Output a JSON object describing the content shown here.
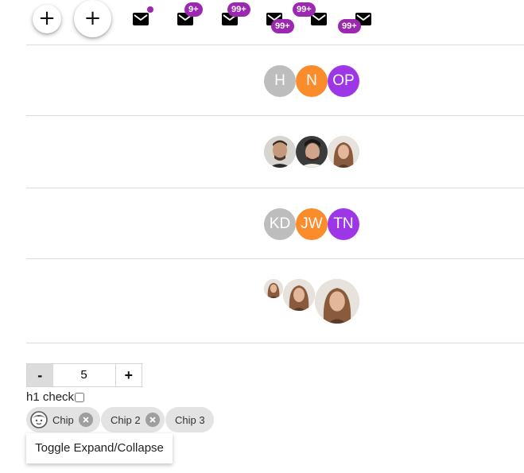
{
  "toolbar": {
    "fab_small_label": "+",
    "fab_large_label": "+",
    "mail_badges": [
      "",
      "9+",
      "99+",
      "99+",
      "99+",
      "99+"
    ],
    "badge_color": "#9c27b0"
  },
  "avatar_groups": [
    {
      "kind": "initials",
      "avatars": [
        {
          "text": "H",
          "color": "#bdbdbd"
        },
        {
          "text": "N",
          "color": "#fb8c2c"
        },
        {
          "text": "OP",
          "color": "#9c36e6"
        }
      ]
    },
    {
      "kind": "photos",
      "avatars": [
        {
          "name": "man-photo-1"
        },
        {
          "name": "man-photo-2"
        },
        {
          "name": "woman-photo"
        }
      ]
    },
    {
      "kind": "initials",
      "avatars": [
        {
          "text": "KD",
          "color": "#bdbdbd"
        },
        {
          "text": "JW",
          "color": "#fb8c2c"
        },
        {
          "text": "TN",
          "color": "#9c36e6"
        }
      ]
    },
    {
      "kind": "photo-sizes",
      "avatars": [
        {
          "name": "woman-photo-small"
        },
        {
          "name": "woman-photo-medium"
        },
        {
          "name": "woman-photo-large"
        }
      ]
    }
  ],
  "stepper": {
    "minus_label": "-",
    "value": "5",
    "plus_label": "+"
  },
  "check": {
    "label": "h1 check",
    "checked": false
  },
  "chips": [
    {
      "label": "Chip",
      "icon": "face-icon",
      "removable": true
    },
    {
      "label": "Chip 2",
      "removable": true
    },
    {
      "label": "Chip 3",
      "removable": false
    }
  ],
  "toggle_button": {
    "label": "Toggle Expand/Collapse"
  }
}
